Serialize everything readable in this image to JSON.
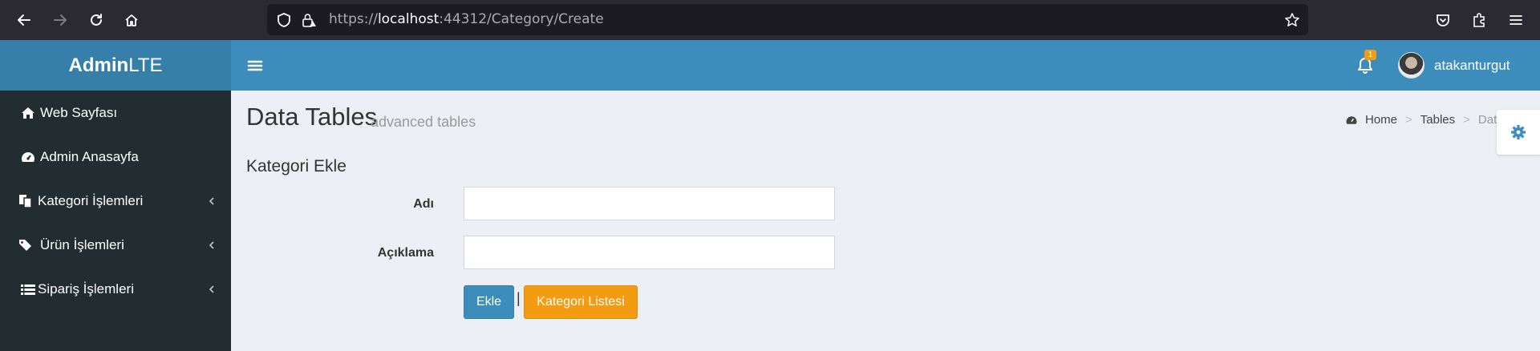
{
  "browser": {
    "url_prefix": "https://",
    "url_host": "localhost",
    "url_rest": ":44312/Category/Create"
  },
  "app": {
    "logo_bold": "Admin",
    "logo_light": "LTE",
    "notification_count": "1",
    "username": "atakanturgut"
  },
  "sidebar": {
    "items": [
      {
        "label": "Web Sayfası",
        "icon": "home-icon",
        "has_submenu": false
      },
      {
        "label": "Admin Anasayfa",
        "icon": "dashboard-icon",
        "has_submenu": false
      },
      {
        "label": "Kategori İşlemleri",
        "icon": "files-icon",
        "has_submenu": true
      },
      {
        "label": "Ürün İşlemleri",
        "icon": "tags-icon",
        "has_submenu": true
      },
      {
        "label": "Sipariş İşlemleri",
        "icon": "list-icon",
        "has_submenu": true
      }
    ]
  },
  "content": {
    "title": "Data Tables",
    "subtitle": "advanced tables",
    "breadcrumb": {
      "home": "Home",
      "tables": "Tables",
      "active": "Data t"
    }
  },
  "form": {
    "title": "Kategori Ekle",
    "name_label": "Adı",
    "name_value": "",
    "desc_label": "Açıklama",
    "desc_value": "",
    "submit_label": "Ekle",
    "separator": "|",
    "list_label": "Kategori Listesi"
  },
  "colors": {
    "primary": "#3c8dbc",
    "warning": "#f39c12",
    "sidebar": "#222d32"
  }
}
